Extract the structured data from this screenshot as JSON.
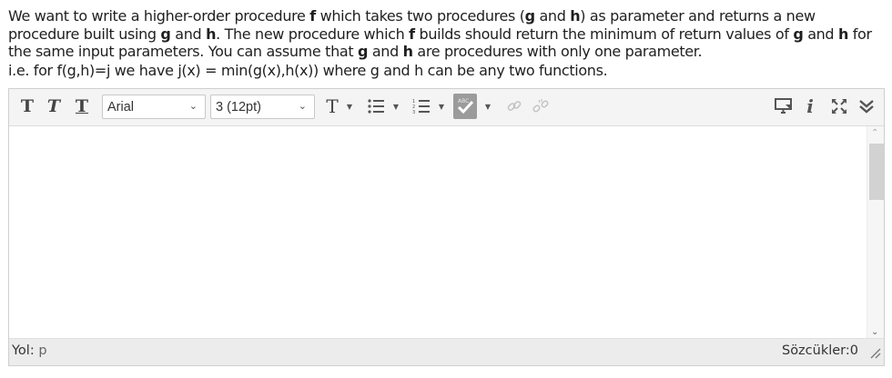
{
  "question": {
    "intro": "We want to write a higher-order procedure ",
    "f1": "f",
    "mid1": " which takes two procedures (",
    "g1": "g",
    "and1": " and ",
    "h1": "h",
    "mid2": ") as parameter and returns a new procedure built using ",
    "g2": "g",
    "and2": " and ",
    "h2": "h",
    "mid3": ". The new procedure which ",
    "f2": "f",
    "mid4": " builds should return the minimum of return values of ",
    "g3": "g",
    "and3": " and ",
    "h3": "h",
    "mid5": " for the same input parameters. You can assume that ",
    "g4": "g",
    "and4": " and ",
    "h4": "h",
    "end": " are procedures with only one parameter.",
    "hint": "i.e. for f(g,h)=j we have j(x) = min(g(x),h(x)) where g and h can be any two functions."
  },
  "toolbar": {
    "bold_icon": "T",
    "italic_icon": "T",
    "underline_icon": "T",
    "font_family": "Arial",
    "font_size": "3 (12pt)",
    "font_color_icon": "T",
    "spell_label": "ABC"
  },
  "icons": {
    "bold": "bold-icon",
    "italic": "italic-icon",
    "underline": "underline-icon",
    "font_color": "font-color-icon",
    "bullet_list": "bullet-list-icon",
    "numbered_list": "numbered-list-icon",
    "spellcheck": "spellcheck-icon",
    "link": "link-icon",
    "unlink": "unlink-icon",
    "media": "media-icon",
    "info": "info-icon",
    "fullscreen": "fullscreen-icon",
    "more": "chevron-double-down-icon"
  },
  "status": {
    "path_label": "Yol:",
    "path_value": "p",
    "word_count": "Sözcükler:0"
  },
  "colors": {
    "toolbar_bg": "#f4f4f4",
    "statusbar_bg": "#ececec",
    "border": "#cfcfcf",
    "spell_active_bg": "#9b9b9b"
  }
}
